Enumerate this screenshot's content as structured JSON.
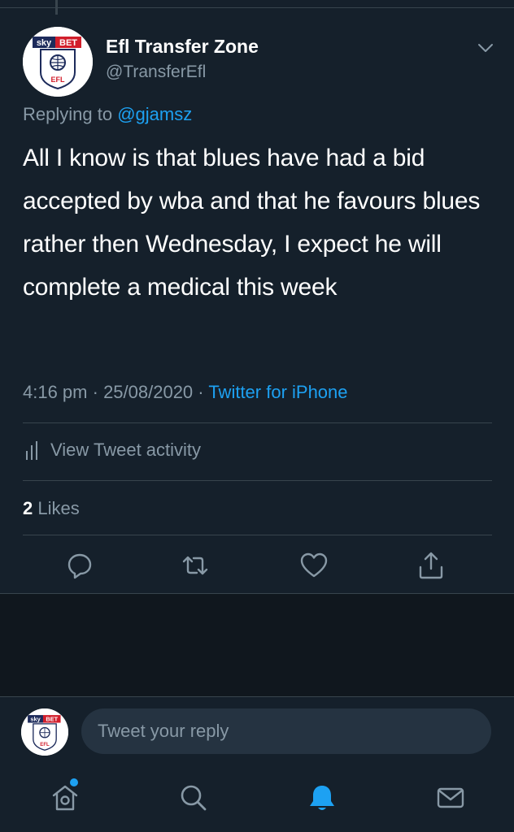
{
  "tweet": {
    "display_name": "Efl Transfer Zone",
    "handle": "@TransferEfl",
    "replying_prefix": "Replying to",
    "replying_to": "@gjamsz",
    "text": "All I know is that blues have had a bid accepted by wba and that he favours blues rather then Wednesday, I expect he will complete a medical this week",
    "time": "4:16 pm",
    "date": "25/08/2020",
    "source": "Twitter for iPhone",
    "separator": " · "
  },
  "avatar_logo": {
    "sky": "sky",
    "bet": "BET",
    "efl": "EFL"
  },
  "activity": {
    "label": "View Tweet activity",
    "icon": "bar-chart-icon"
  },
  "engagement": {
    "likes_count": "2",
    "likes_label": "Likes"
  },
  "actions": [
    {
      "name": "reply",
      "icon": "reply-icon"
    },
    {
      "name": "retweet",
      "icon": "retweet-icon"
    },
    {
      "name": "like",
      "icon": "heart-icon"
    },
    {
      "name": "share",
      "icon": "share-icon"
    }
  ],
  "reply_box": {
    "placeholder": "Tweet your reply"
  },
  "tabbar": {
    "items": [
      "home-icon",
      "search-icon",
      "notifications-icon",
      "messages-icon"
    ],
    "active": "notifications"
  },
  "colors": {
    "background": "#15202b",
    "accent": "#1da1f2",
    "secondary_text": "#8899a6",
    "divider": "#38444d",
    "sky_bet_red": "#d21e2b",
    "efl_navy": "#1d2b5b"
  }
}
